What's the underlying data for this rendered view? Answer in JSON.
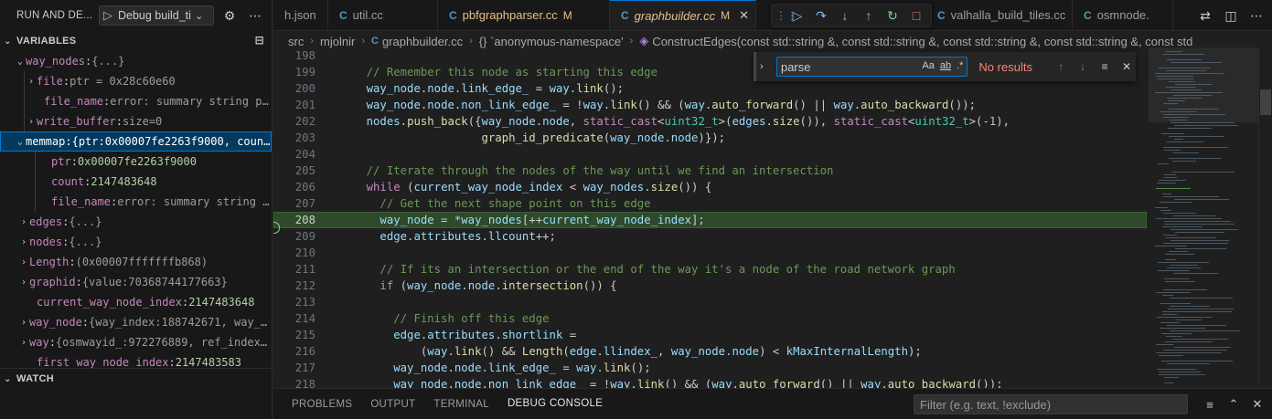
{
  "run": {
    "title": "RUN AND DE...",
    "config_name": "Debug build_tile"
  },
  "variables": {
    "header": "VARIABLES",
    "rows": [
      {
        "twisty": "down",
        "name": "way_nodes",
        "value": "{...}"
      },
      {
        "twisty": "right",
        "name": "file",
        "value": "ptr = 0x28c60e60"
      },
      {
        "twisty": "",
        "name": "file_name",
        "value": "error: summary string pars..."
      },
      {
        "twisty": "right",
        "name": "write_buffer",
        "value": "size=0"
      },
      {
        "twisty": "down",
        "name": "memmap",
        "value": "{ptr:0x00007fe2263f9000, coun..."
      },
      {
        "twisty": "",
        "name": "ptr",
        "value": "0x00007fe2263f9000"
      },
      {
        "twisty": "",
        "name": "count",
        "value": "2147483648"
      },
      {
        "twisty": "",
        "name": "file_name",
        "value": "error: summary string par..."
      },
      {
        "twisty": "right",
        "name": "edges",
        "value": "{...}"
      },
      {
        "twisty": "right",
        "name": "nodes",
        "value": "{...}"
      },
      {
        "twisty": "right",
        "name": "Length",
        "value": "(0x00007fffffffb868)"
      },
      {
        "twisty": "right",
        "name": "graphid",
        "value": "{value:70368744177663}"
      },
      {
        "twisty": "",
        "name": "current_way_node_index",
        "value": "2147483648"
      },
      {
        "twisty": "right",
        "name": "way_node",
        "value": "{way_index:188742671, way_sh..."
      },
      {
        "twisty": "right",
        "name": "way",
        "value": "{osmwayid_:972276889, ref_index_:..."
      },
      {
        "twisty": "",
        "name": "first_way_node_index",
        "value": "2147483583"
      }
    ]
  },
  "watch": {
    "header": "WATCH"
  },
  "tabs": [
    {
      "label": "h.json",
      "lang": "",
      "modified": "",
      "active": false
    },
    {
      "label": "util.cc",
      "lang": "C",
      "modified": "",
      "active": false
    },
    {
      "label": "pbfgraphparser.cc",
      "lang": "C",
      "modified": "M",
      "active": false
    },
    {
      "label": "graphbuilder.cc",
      "lang": "C",
      "modified": "M",
      "active": true
    },
    {
      "label": "valhalla_build_tiles.cc",
      "lang": "C",
      "modified": "",
      "active": false
    },
    {
      "label": "osmnode.",
      "lang": "C",
      "modified": "",
      "active": false
    }
  ],
  "breadcrumbs": [
    "src",
    "mjolnir",
    "graphbuilder.cc",
    "{} `anonymous-namespace'",
    "ConstructEdges(const std::string &, const std::string &, const std::string &, const std::string &, const std"
  ],
  "find": {
    "query": "parse",
    "case_label": "Aa",
    "word_label": "ab",
    "regex_label": ".*",
    "status": "No results"
  },
  "code": {
    "current_line": 208,
    "lines": [
      {
        "n": "198",
        "t": ""
      },
      {
        "n": "199",
        "t": "    // Remember this node as starting this edge"
      },
      {
        "n": "200",
        "t": "    way_node.node.link_edge_ = way.link();"
      },
      {
        "n": "201",
        "t": "    way_node.node.non_link_edge_ = !way.link() && (way.auto_forward() || way.auto_backward());"
      },
      {
        "n": "202",
        "t": "    nodes.push_back({way_node.node, static_cast<uint32_t>(edges.size()), static_cast<uint32_t>(-1),"
      },
      {
        "n": "203",
        "t": "                     graph_id_predicate(way_node.node)});"
      },
      {
        "n": "204",
        "t": ""
      },
      {
        "n": "205",
        "t": "    // Iterate through the nodes of the way until we find an intersection"
      },
      {
        "n": "206",
        "t": "    while (current_way_node_index < way_nodes.size()) {"
      },
      {
        "n": "207",
        "t": "      // Get the next shape point on this edge"
      },
      {
        "n": "208",
        "t": "      way_node = *way_nodes[++current_way_node_index];"
      },
      {
        "n": "209",
        "t": "      edge.attributes.llcount++;"
      },
      {
        "n": "210",
        "t": ""
      },
      {
        "n": "211",
        "t": "      // If its an intersection or the end of the way it's a node of the road network graph"
      },
      {
        "n": "212",
        "t": "      if (way_node.node.intersection()) {"
      },
      {
        "n": "213",
        "t": ""
      },
      {
        "n": "214",
        "t": "        // Finish off this edge"
      },
      {
        "n": "215",
        "t": "        edge.attributes.shortlink ="
      },
      {
        "n": "216",
        "t": "            (way.link() && Length(edge.llindex_, way_node.node) < kMaxInternalLength);"
      },
      {
        "n": "217",
        "t": "        way_node.node.link_edge_ = way.link();"
      },
      {
        "n": "218",
        "t": "        way_node.node.non_link_edge_ = !way.link() && (way.auto_forward() || way.auto_backward());"
      }
    ]
  },
  "panel": {
    "tabs": [
      "PROBLEMS",
      "OUTPUT",
      "TERMINAL",
      "DEBUG CONSOLE"
    ],
    "active_tab": "DEBUG CONSOLE",
    "filter_placeholder": "Filter (e.g. text, !exclude)"
  },
  "colors": {
    "accent": "#0078d4",
    "current_line": "#2e4a2a",
    "stack_frame_marker": "#89d185",
    "find_no_results": "#f48771"
  }
}
